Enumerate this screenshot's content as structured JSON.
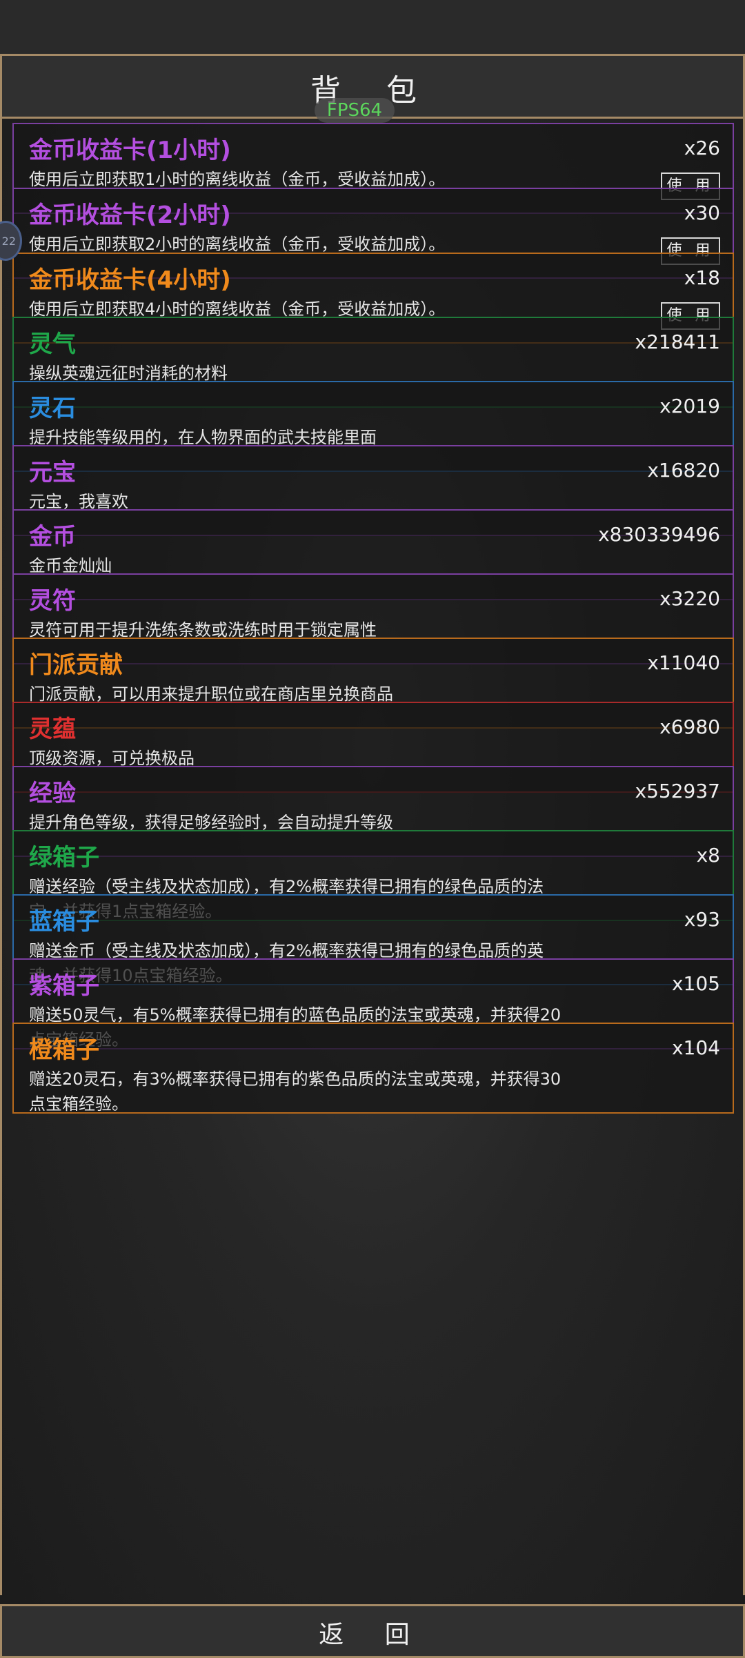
{
  "header": {
    "title": "背 包"
  },
  "fps_label": "FPS64",
  "side_bubble": "22",
  "items": [
    {
      "name": "金币收益卡(1小时)",
      "desc": "使用后立即获取1小时的离线收益（金币，受收益加成）。",
      "count": "x26",
      "color": "#b44fe0",
      "border": "#7a3fa0",
      "button": "使 用"
    },
    {
      "name": "金币收益卡(2小时)",
      "desc": "使用后立即获取2小时的离线收益（金币，受收益加成）。",
      "count": "x30",
      "color": "#b44fe0",
      "border": "#7a3fa0",
      "button": "使 用"
    },
    {
      "name": "金币收益卡(4小时)",
      "desc": "使用后立即获取4小时的离线收益（金币，受收益加成）。",
      "count": "x18",
      "color": "#f08a1c",
      "border": "#b86a1c",
      "button": "使 用"
    },
    {
      "name": "灵气",
      "desc": "操纵英魂远征时消耗的材料",
      "count": "x218411",
      "color": "#1fa84a",
      "border": "#1f7a3a"
    },
    {
      "name": "灵石",
      "desc": "提升技能等级用的，在人物界面的武夫技能里面",
      "count": "x2019",
      "color": "#2a8de0",
      "border": "#2a6aa8"
    },
    {
      "name": "元宝",
      "desc": "元宝，我喜欢",
      "count": "x16820",
      "color": "#b44fe0",
      "border": "#7a3fa0"
    },
    {
      "name": "金币",
      "desc": "金币金灿灿",
      "count": "x830339496",
      "color": "#b44fe0",
      "border": "#7a3fa0"
    },
    {
      "name": "灵符",
      "desc": "灵符可用于提升洗练条数或洗练时用于锁定属性",
      "count": "x3220",
      "color": "#b44fe0",
      "border": "#7a3fa0"
    },
    {
      "name": "门派贡献",
      "desc": "门派贡献，可以用来提升职位或在商店里兑换商品",
      "count": "x11040",
      "color": "#f08a1c",
      "border": "#b86a1c"
    },
    {
      "name": "灵蕴",
      "desc": "顶级资源，可兑换极品",
      "count": "x6980",
      "color": "#e03030",
      "border": "#a82a2a"
    },
    {
      "name": "经验",
      "desc": "提升角色等级，获得足够经验时，会自动提升等级",
      "count": "x552937",
      "color": "#b44fe0",
      "border": "#7a3fa0"
    },
    {
      "name": "绿箱子",
      "desc": "赠送经验（受主线及状态加成），有2%概率获得已拥有的绿色品质的法宝，并获得1点宝箱经验。",
      "count": "x8",
      "color": "#1fa84a",
      "border": "#1f7a3a"
    },
    {
      "name": "蓝箱子",
      "desc": "赠送金币（受主线及状态加成），有2%概率获得已拥有的绿色品质的英魂，并获得10点宝箱经验。",
      "count": "x93",
      "color": "#2a8de0",
      "border": "#2a6aa8"
    },
    {
      "name": "紫箱子",
      "desc": "赠送50灵气，有5%概率获得已拥有的蓝色品质的法宝或英魂，并获得20点宝箱经验。",
      "count": "x105",
      "color": "#b44fe0",
      "border": "#7a3fa0"
    },
    {
      "name": "橙箱子",
      "desc": "赠送20灵石，有3%概率获得已拥有的紫色品质的法宝或英魂，并获得30点宝箱经验。",
      "count": "x104",
      "color": "#f08a1c",
      "border": "#b86a1c"
    }
  ],
  "footer": {
    "back_label": "返 回"
  }
}
